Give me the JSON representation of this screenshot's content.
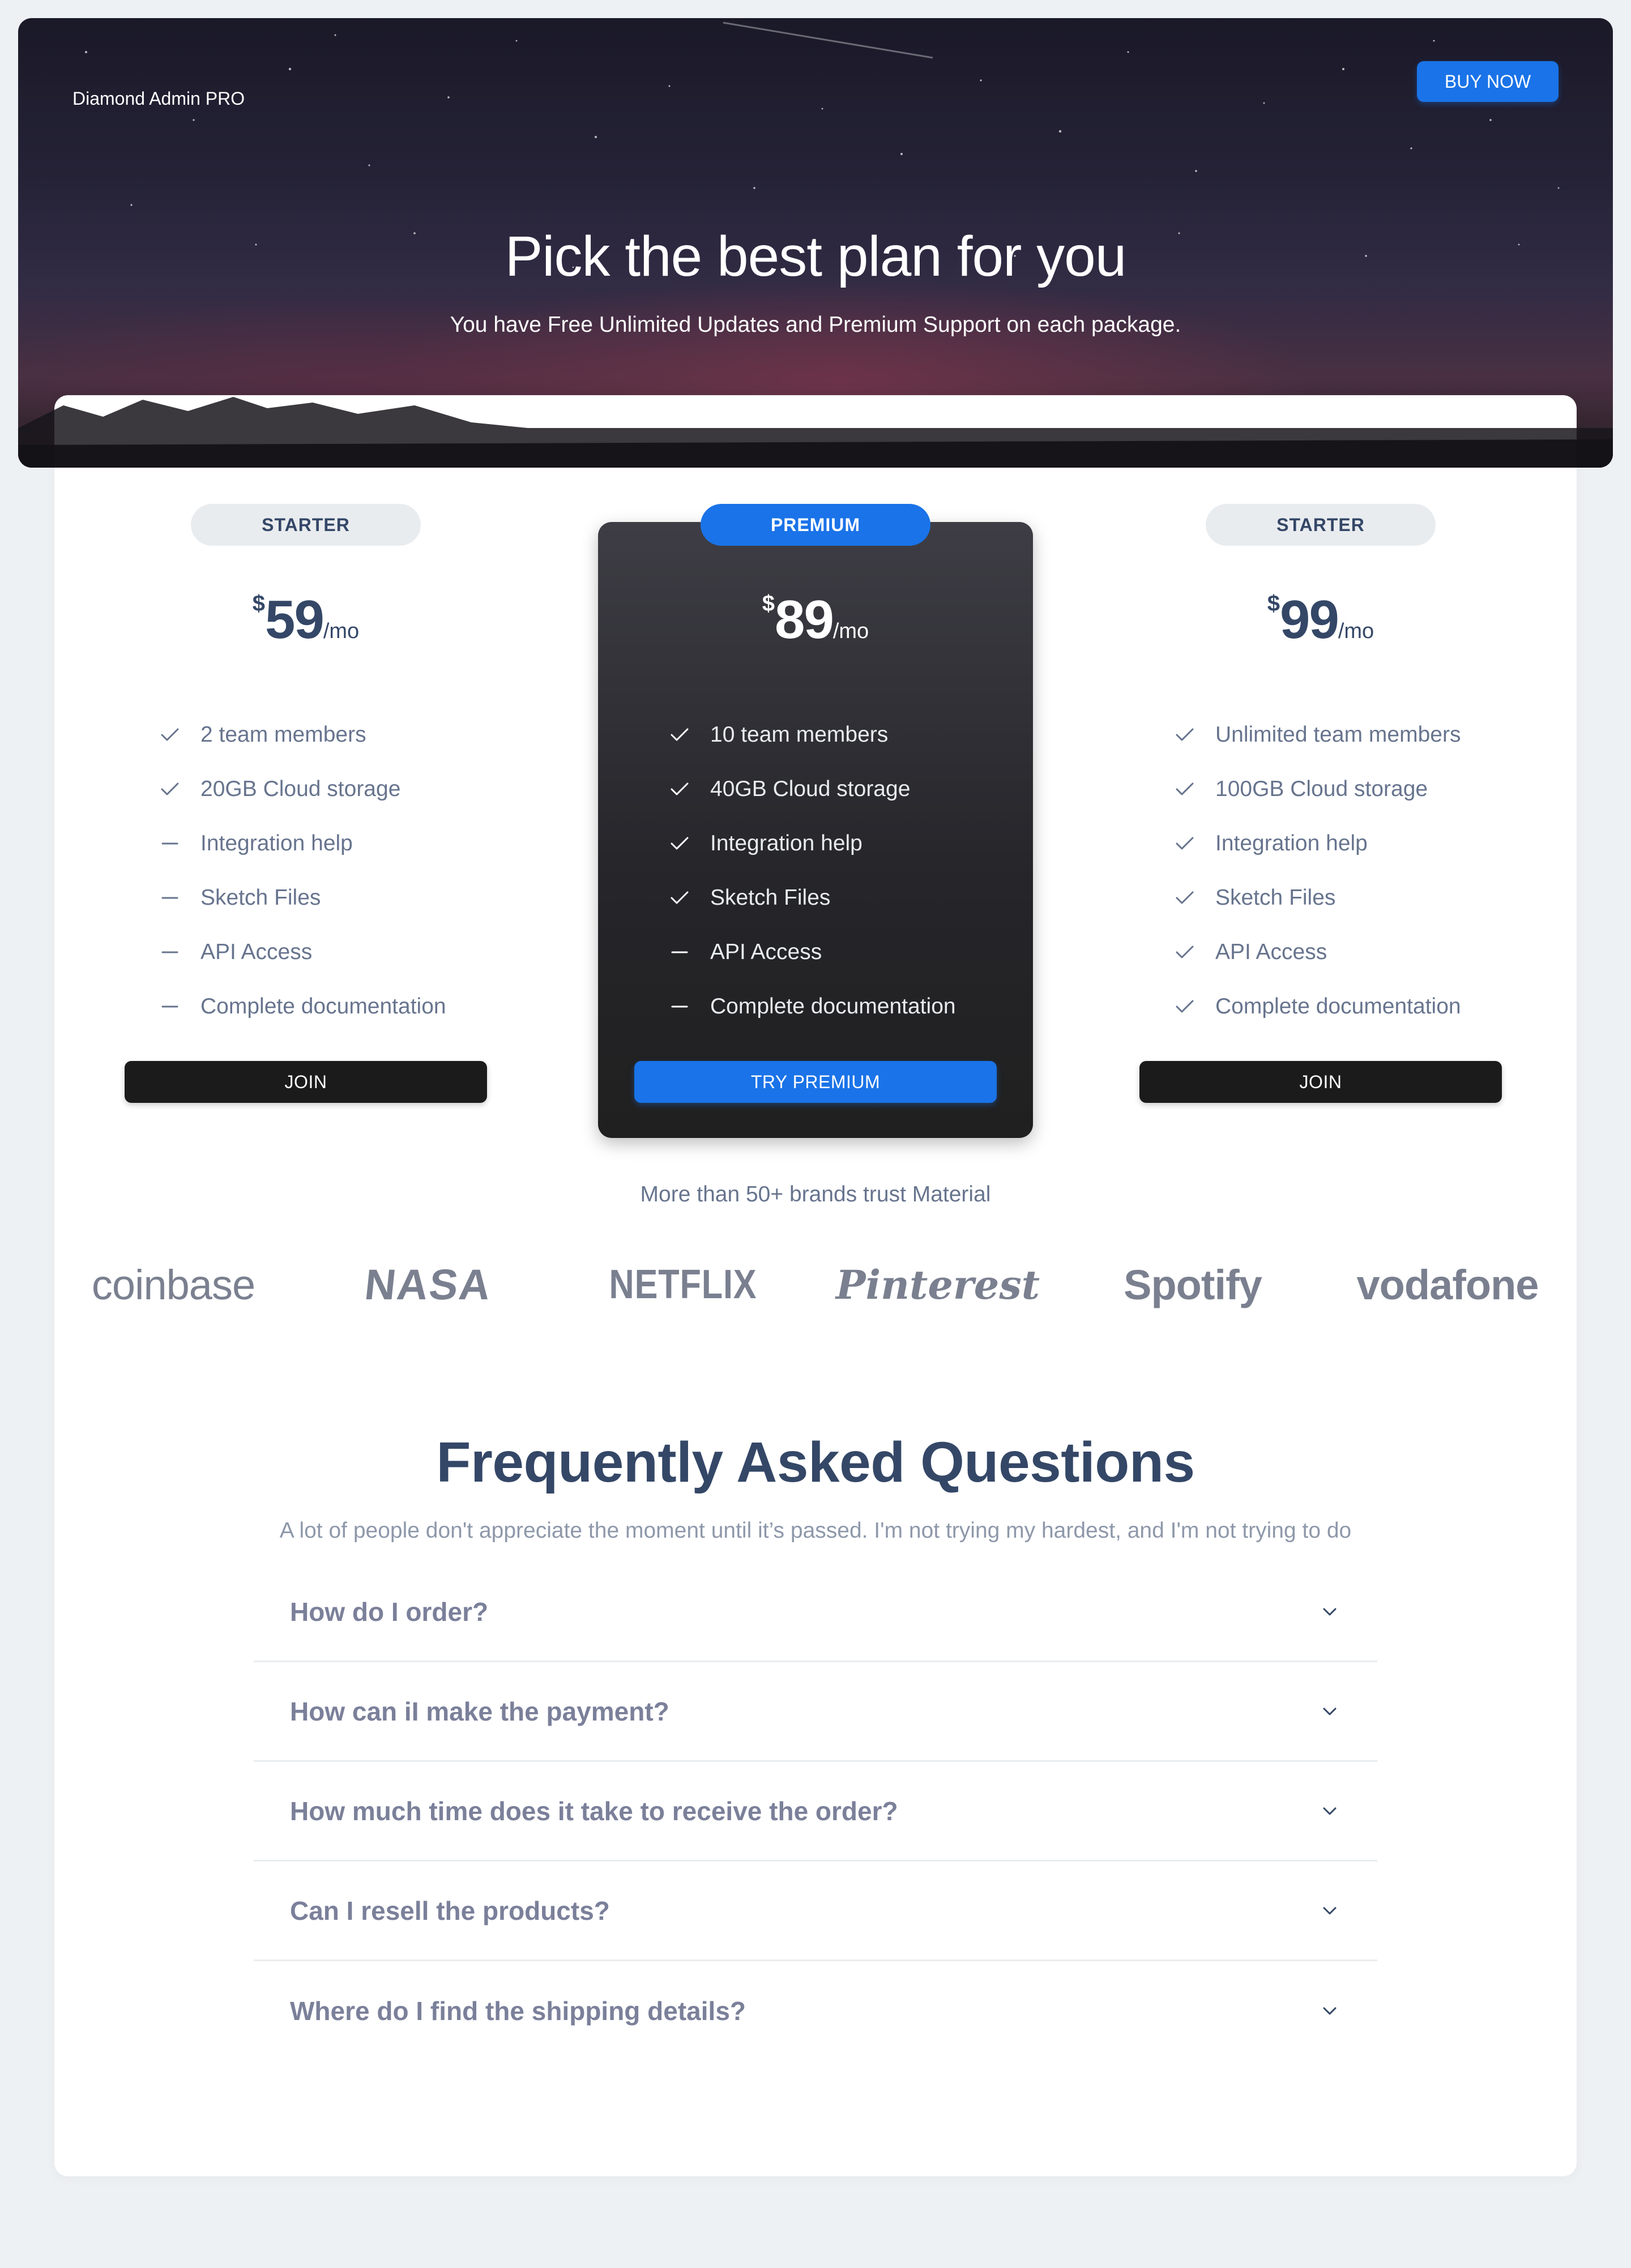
{
  "header": {
    "brand": "Diamond Admin PRO",
    "buy_label": "BUY NOW",
    "title": "Pick the best plan for you",
    "subtitle": "You have Free Unlimited Updates and Premium Support on each package."
  },
  "plans": [
    {
      "badge": "STARTER",
      "currency": "$",
      "price": "59",
      "period": "/mo",
      "features": [
        {
          "label": "2 team members",
          "included": true
        },
        {
          "label": "20GB Cloud storage",
          "included": true
        },
        {
          "label": "Integration help",
          "included": false
        },
        {
          "label": "Sketch Files",
          "included": false
        },
        {
          "label": "API Access",
          "included": false
        },
        {
          "label": "Complete documentation",
          "included": false
        }
      ],
      "button": "JOIN"
    },
    {
      "badge": "PREMIUM",
      "currency": "$",
      "price": "89",
      "period": "/mo",
      "features": [
        {
          "label": "10 team members",
          "included": true
        },
        {
          "label": "40GB Cloud storage",
          "included": true
        },
        {
          "label": "Integration help",
          "included": true
        },
        {
          "label": "Sketch Files",
          "included": true
        },
        {
          "label": "API Access",
          "included": false
        },
        {
          "label": "Complete documentation",
          "included": false
        }
      ],
      "button": "TRY PREMIUM"
    },
    {
      "badge": "STARTER",
      "currency": "$",
      "price": "99",
      "period": "/mo",
      "features": [
        {
          "label": "Unlimited team members",
          "included": true
        },
        {
          "label": "100GB Cloud storage",
          "included": true
        },
        {
          "label": "Integration help",
          "included": true
        },
        {
          "label": "Sketch Files",
          "included": true
        },
        {
          "label": "API Access",
          "included": true
        },
        {
          "label": "Complete documentation",
          "included": true
        }
      ],
      "button": "JOIN"
    }
  ],
  "brands": {
    "caption": "More than 50+ brands trust Material",
    "logos": [
      "coinbase",
      "NASA",
      "NETFLIX",
      "Pinterest",
      "Spotify",
      "vodafone"
    ]
  },
  "faq": {
    "title": "Frequently Asked Questions",
    "subtitle": "A lot of people don't appreciate the moment until it’s passed. I'm not trying my hardest, and I'm not trying to do",
    "questions": [
      "How do I order?",
      "How can iI make the payment?",
      "How much time does it take to receive the order?",
      "Can I resell the products?",
      "Where do I find the shipping details?"
    ]
  },
  "icons": {
    "included": "check-icon",
    "excluded": "dash-icon",
    "expand": "chevron-down-icon"
  },
  "colors": {
    "accent": "#1a73e8",
    "heading": "#344767",
    "muted": "#67748e",
    "dark_button": "#1b1b1b",
    "page_bg": "#eef1f4"
  }
}
